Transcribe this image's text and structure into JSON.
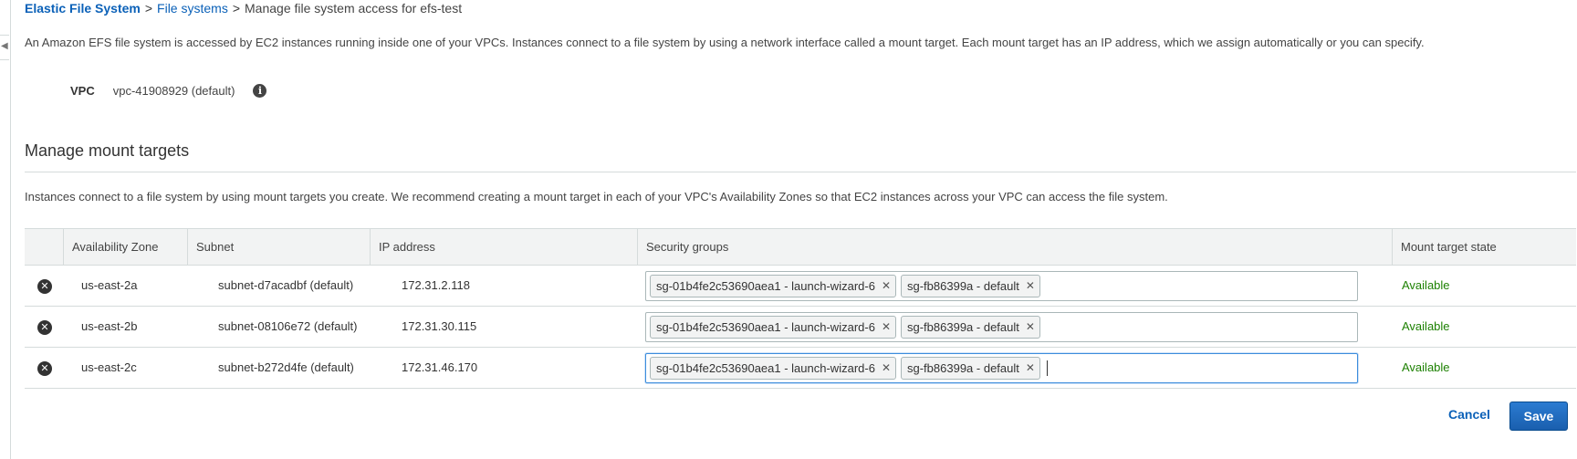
{
  "breadcrumb": {
    "root": "Elastic File System",
    "separator": ">",
    "parent": "File systems",
    "current": "Manage file system access for efs-test"
  },
  "intro": "An Amazon EFS file system is accessed by EC2 instances running inside one of your VPCs. Instances connect to a file system by using a network interface called a mount target. Each mount target has an IP address, which we assign automatically or you can specify.",
  "vpc": {
    "label": "VPC",
    "value": "vpc-41908929 (default)",
    "info_icon": "info-icon"
  },
  "section": {
    "title": "Manage mount targets",
    "description": "Instances connect to a file system by using mount targets you create. We recommend creating a mount target in each of your VPC's Availability Zones so that EC2 instances across your VPC can access the file system."
  },
  "table": {
    "headers": {
      "az": "Availability Zone",
      "subnet": "Subnet",
      "ip": "IP address",
      "sg": "Security groups",
      "state": "Mount target state"
    },
    "rows": [
      {
        "az": "us-east-2a",
        "subnet": "subnet-d7acadbf (default)",
        "ip": "172.31.2.118",
        "security_groups": [
          "sg-01b4fe2c53690aea1 - launch-wizard-6",
          "sg-fb86399a - default"
        ],
        "state": "Available"
      },
      {
        "az": "us-east-2b",
        "subnet": "subnet-08106e72 (default)",
        "ip": "172.31.30.115",
        "security_groups": [
          "sg-01b4fe2c53690aea1 - launch-wizard-6",
          "sg-fb86399a - default"
        ],
        "state": "Available"
      },
      {
        "az": "us-east-2c",
        "subnet": "subnet-b272d4fe (default)",
        "ip": "172.31.46.170",
        "security_groups": [
          "sg-01b4fe2c53690aea1 - launch-wizard-6",
          "sg-fb86399a - default"
        ],
        "state": "Available"
      }
    ]
  },
  "actions": {
    "cancel": "Cancel",
    "save": "Save"
  },
  "colors": {
    "link": "#0b61b8",
    "available": "#1d8102",
    "primary_button": "#1a5fae",
    "focus_border": "#3c8ddc"
  },
  "icons": {
    "remove": "close-circle-icon",
    "token_remove": "close-icon",
    "info": "info-icon",
    "collapse": "chevron-left-icon"
  }
}
